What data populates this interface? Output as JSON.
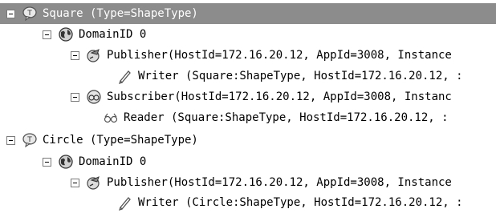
{
  "tree": {
    "rows": [
      {
        "icon": "topic-icon",
        "text": "Square (Type=ShapeType)",
        "selected": true
      },
      {
        "icon": "domain-globe-icon",
        "text": "DomainID 0"
      },
      {
        "icon": "publisher-icon",
        "text": "Publisher(HostId=172.16.20.12, AppId=3008, Instance"
      },
      {
        "icon": "writer-pen-icon",
        "text": "Writer  (Square:ShapeType, HostId=172.16.20.12, :"
      },
      {
        "icon": "subscriber-icon",
        "text": "Subscriber(HostId=172.16.20.12, AppId=3008, Instanc"
      },
      {
        "icon": "reader-glasses-icon",
        "text": "Reader  (Square:ShapeType, HostId=172.16.20.12, :"
      },
      {
        "icon": "topic-icon",
        "text": "Circle (Type=ShapeType)"
      },
      {
        "icon": "domain-globe-icon",
        "text": "DomainID 0"
      },
      {
        "icon": "publisher-icon",
        "text": "Publisher(HostId=172.16.20.12, AppId=3008, Instance"
      },
      {
        "icon": "writer-pen-icon",
        "text": "Writer  (Circle:ShapeType, HostId=172.16.20.12, :"
      }
    ]
  }
}
